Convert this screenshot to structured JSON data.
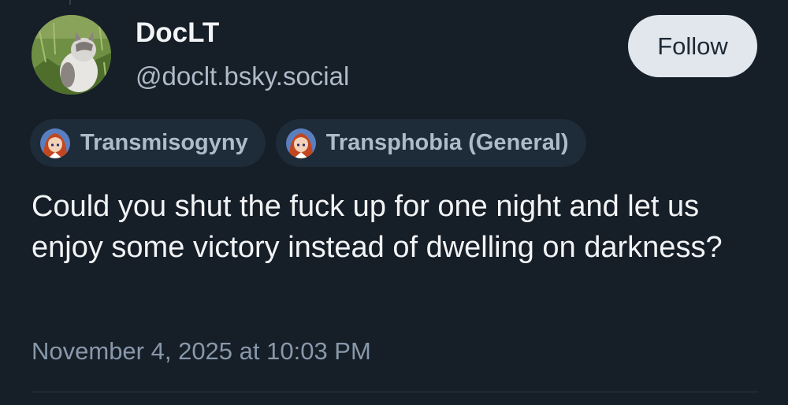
{
  "author": {
    "display_name": "DocLT",
    "handle": "@doclt.bsky.social",
    "avatar_icon": "cat-photo-avatar"
  },
  "follow_button": {
    "label": "Follow"
  },
  "labels": [
    {
      "icon": "anime-character-avatar",
      "text": "Transmisogyny"
    },
    {
      "icon": "anime-character-avatar",
      "text": "Transphobia (General)"
    }
  ],
  "post": {
    "text": "Could you shut the fuck up for one night and let us enjoy some victory instead of dwelling on darkness?",
    "timestamp": "November 4, 2025 at 10:03 PM"
  },
  "colors": {
    "background": "#161e27",
    "label_pill": "#1e2b38",
    "follow_button_bg": "#e2e7ee",
    "muted_text": "#aebbc9"
  }
}
